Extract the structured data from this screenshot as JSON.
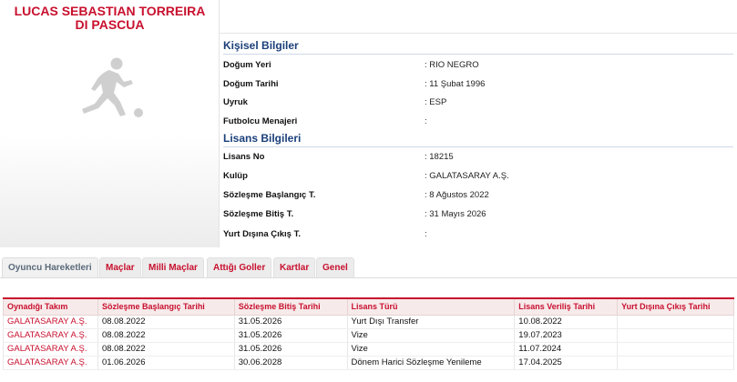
{
  "player": {
    "name": "LUCAS SEBASTIAN TORREIRA DI PASCUA"
  },
  "personal": {
    "title": "Kişisel Bilgiler",
    "rows": [
      {
        "label": "Doğum Yeri",
        "value": ":  RIO NEGRO"
      },
      {
        "label": "Doğum Tarihi",
        "value": ":  11 Şubat 1996"
      },
      {
        "label": "Uyruk",
        "value": ":  ESP"
      },
      {
        "label": "Futbolcu Menajeri",
        "value": ":"
      }
    ]
  },
  "license": {
    "title": "Lisans Bilgileri",
    "rows": [
      {
        "label": "Lisans No",
        "value": ": 18215"
      },
      {
        "label": "Kulüp",
        "value": ": GALATASARAY A.Ş."
      },
      {
        "label": "Sözleşme Başlangıç T.",
        "value": ": 8 Ağustos 2022"
      },
      {
        "label": "Sözleşme Bitiş T.",
        "value": ": 31 Mayıs 2026"
      },
      {
        "label": "Yurt Dışına Çıkış T.",
        "value": ":"
      }
    ]
  },
  "tabs": [
    {
      "label": "Oyuncu Hareketleri",
      "active": true
    },
    {
      "label": "Maçlar",
      "active": false
    },
    {
      "label": "Milli Maçlar",
      "active": false
    },
    {
      "label": "Attığı Goller",
      "active": false
    },
    {
      "label": "Kartlar",
      "active": false
    },
    {
      "label": "Genel",
      "active": false
    }
  ],
  "table": {
    "headers": [
      "Oynadığı Takım",
      "Sözleşme Başlangıç Tarihi",
      "Sözleşme Bitiş Tarihi",
      "Lisans Türü",
      "Lisans Veriliş Tarihi",
      "Yurt Dışına Çıkış Tarihi"
    ],
    "rows": [
      [
        "GALATASARAY A.Ş.",
        "08.08.2022",
        "31.05.2026",
        "Yurt Dışı Transfer",
        "10.08.2022",
        ""
      ],
      [
        "GALATASARAY A.Ş.",
        "08.08.2022",
        "31.05.2026",
        "Vize",
        "19.07.2023",
        ""
      ],
      [
        "GALATASARAY A.Ş.",
        "08.08.2022",
        "31.05.2026",
        "Vize",
        "11.07.2024",
        ""
      ],
      [
        "GALATASARAY A.Ş.",
        "01.06.2026",
        "30.06.2028",
        "Dönem Harici Sözleşme Yenileme",
        "17.04.2025",
        ""
      ]
    ]
  },
  "colors": {
    "accent": "#c8102e",
    "section": "#1a3f7a"
  },
  "icons": {
    "player": "player-silhouette-icon"
  }
}
